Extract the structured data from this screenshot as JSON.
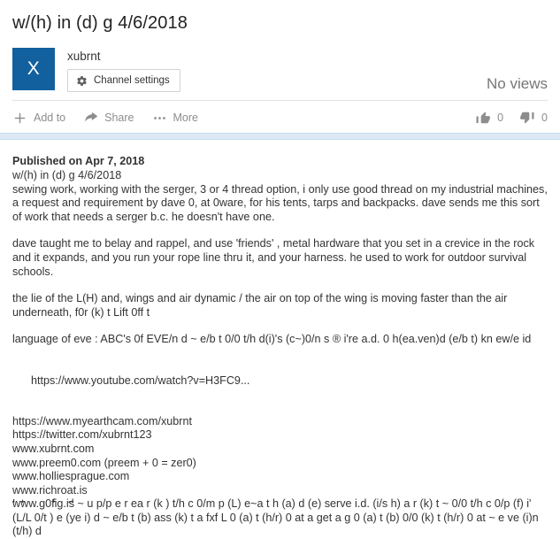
{
  "video": {
    "title": "w/(h) in (d) g 4/6/2018",
    "views_text": "No views"
  },
  "owner": {
    "avatar_letter": "X",
    "avatar_color": "#12609e",
    "channel_name": "xubrnt",
    "channel_settings_label": "Channel settings",
    "gear_icon": "gear-icon"
  },
  "actions": {
    "add_to_label": "Add to",
    "add_to_icon": "plus-icon",
    "share_label": "Share",
    "share_icon": "share-arrow-icon",
    "more_label": "More",
    "more_icon": "ellipsis-icon",
    "like_count": "0",
    "like_icon": "thumbs-up-icon",
    "dislike_count": "0",
    "dislike_icon": "thumbs-down-icon"
  },
  "description": {
    "published": "Published on Apr 7, 2018",
    "line_title": "w/(h) in (d) g 4/6/2018",
    "para_sewing": "sewing work, working with the serger, 3 or 4 thread option, i only use good thread on my industrial machines, a request and requirement by dave 0, at 0ware, for his tents, tarps and backpacks. dave sends me this sort of work that needs a serger b.c. he doesn't have one.",
    "para_dave": "dave taught me to belay and rappel, and use 'friends' , metal hardware that you set in a crevice in the rock and it expands, and you run your rope line thru it, and your harness. he used to work for outdoor survival schools.",
    "para_lie": "the lie of the L(H) and, wings and air dynamic / the air on top of the wing is moving faster than the air underneath, f0r (k) t Lift 0ff t",
    "para_language": "language of eve : ABC's 0f EVE/n d ~ e/b t 0/0 t/h d(i)'s (c~)0/n s ® i're a.d. 0 h(ea.ven)d (e/b t) kn ew/e id",
    "link_youtube": "https://www.youtube.com/watch?v=H3FC9...",
    "links": [
      "https://www.myearthcam.com/xubrnt",
      "https://twitter.com/xubrnt123",
      "www.xubrnt.com",
      "www.preem0.com (preem + 0 = zer0)",
      "www.holliesprague.com",
      "www.richroat.is"
    ],
    "para_g0fig": "www.g0fig.is ~ u p/p e r ea r (k ) t/h c 0/m p (L) e~a t h (a) d (e) serve i.d. (i/s h) a r (k) t ~ 0/0 t/h c 0/p (f) i' (L/L 0/t ) e (ye i) d ~ e/b t (b) ass (k) t a fxf L 0 (a) t (h/r) 0 at a get a g 0 (a) t (b) 0/0 (k) t (h/r) 0 at ~ e ve (i)n (t/h) d",
    "clipped_line": "L t .. . .. f .. d"
  }
}
